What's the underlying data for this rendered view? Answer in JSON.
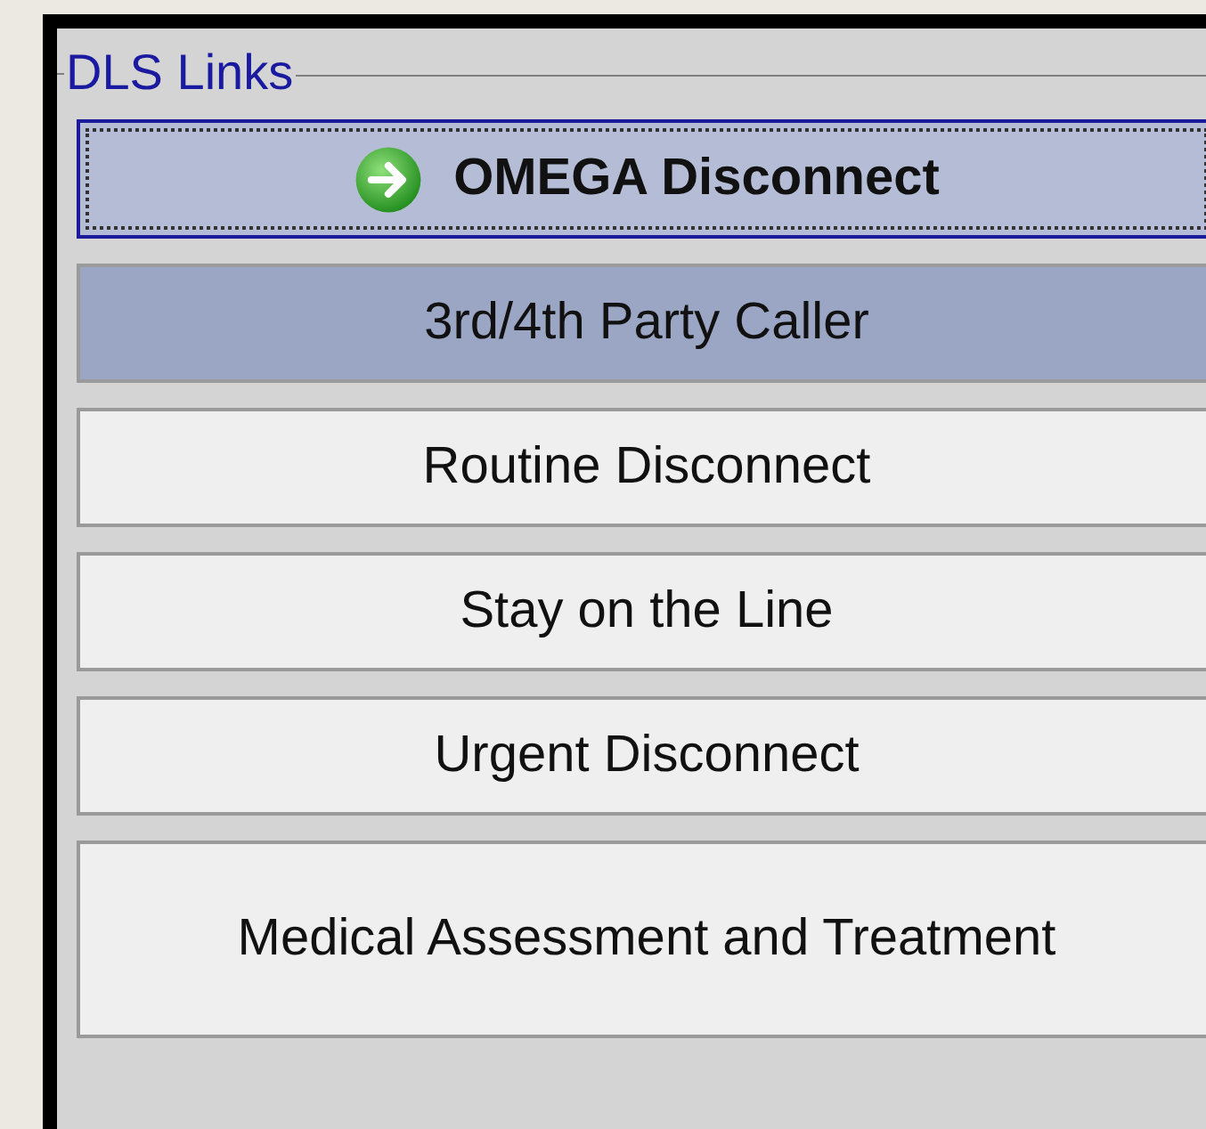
{
  "group": {
    "title": "DLS Links"
  },
  "buttons": [
    {
      "label": "OMEGA Disconnect",
      "kind": "icon",
      "focused": true,
      "hovered": false
    },
    {
      "label": "3rd/4th Party Caller",
      "kind": "plain",
      "focused": false,
      "hovered": true
    },
    {
      "label": "Routine Disconnect",
      "kind": "plain",
      "focused": false,
      "hovered": false
    },
    {
      "label": "Stay on the Line",
      "kind": "plain",
      "focused": false,
      "hovered": false
    },
    {
      "label": "Urgent Disconnect",
      "kind": "plain",
      "focused": false,
      "hovered": false
    },
    {
      "label": "Medical Assessment and Treatment",
      "kind": "tall",
      "focused": false,
      "hovered": false
    }
  ]
}
